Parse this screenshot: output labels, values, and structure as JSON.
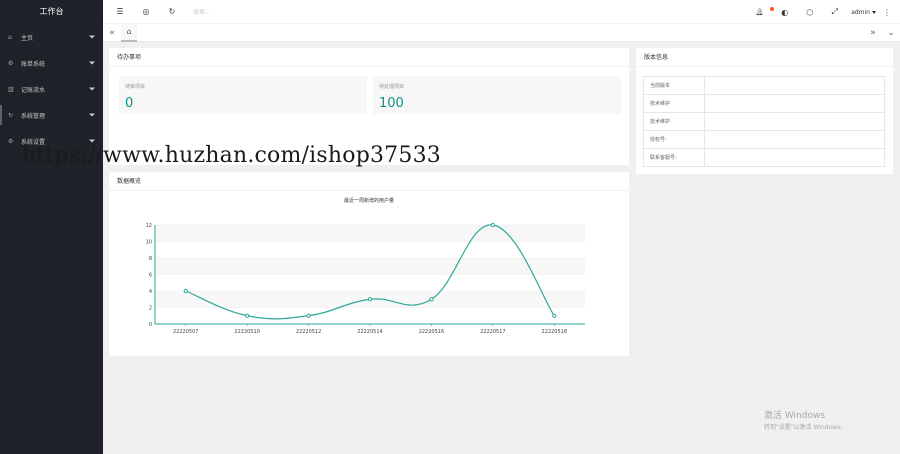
{
  "sidebar": {
    "logo": "工作台",
    "items": [
      {
        "label": "主页",
        "icon": "home-icon",
        "glyph": "⌂"
      },
      {
        "label": "账单系统",
        "icon": "gear-icon",
        "glyph": "⚙"
      },
      {
        "label": "记账流水",
        "icon": "list-icon",
        "glyph": "▥"
      },
      {
        "label": "系统管理",
        "icon": "refresh-icon",
        "glyph": "↻"
      },
      {
        "label": "系统设置",
        "icon": "settings-icon",
        "glyph": "⚙"
      }
    ]
  },
  "header": {
    "menu_icon": "☰",
    "globe_icon": "◎",
    "refresh_icon": "↻",
    "search_placeholder": "搜索...",
    "bell_icon": "🔔",
    "theme_icon": "◐",
    "tag_icon": "⬡",
    "fullscreen_icon": "⤢",
    "user": "admin",
    "more_icon": "⋮"
  },
  "tabs": {
    "left_arrow": "«",
    "home_icon": "⌂",
    "right_arrow": "»",
    "dropdown": "⌄"
  },
  "todo": {
    "title": "待办事项",
    "stats": [
      {
        "label": "待审项目",
        "value": "0"
      },
      {
        "label": "待处理项目",
        "value": "100"
      }
    ]
  },
  "version": {
    "title": "版本信息",
    "rows": [
      {
        "key": "当前版本",
        "value": ""
      },
      {
        "key": "技术维护",
        "value": ""
      },
      {
        "key": "技术维护",
        "value": ""
      },
      {
        "key": "授权号:",
        "value": ""
      },
      {
        "key": "联系客服号:",
        "value": ""
      }
    ]
  },
  "overview": {
    "title": "数据概览"
  },
  "chart_data": {
    "type": "line",
    "title": "最近一周新增的用户量",
    "categories": [
      "22220507",
      "22220510",
      "22220512",
      "22220514",
      "22220516",
      "22220517",
      "22220518"
    ],
    "values": [
      4,
      1,
      1,
      3,
      3,
      12,
      1
    ],
    "ylim": [
      0,
      12
    ],
    "yticks": [
      0,
      2,
      4,
      6,
      8,
      10,
      12
    ],
    "color": "#2fa89a",
    "grid": true
  },
  "watermark": "https://www.huzhan.com/ishop37533",
  "windows_activation": {
    "line1": "激活 Windows",
    "line2": "转到\"设置\"以激活 Windows。"
  }
}
